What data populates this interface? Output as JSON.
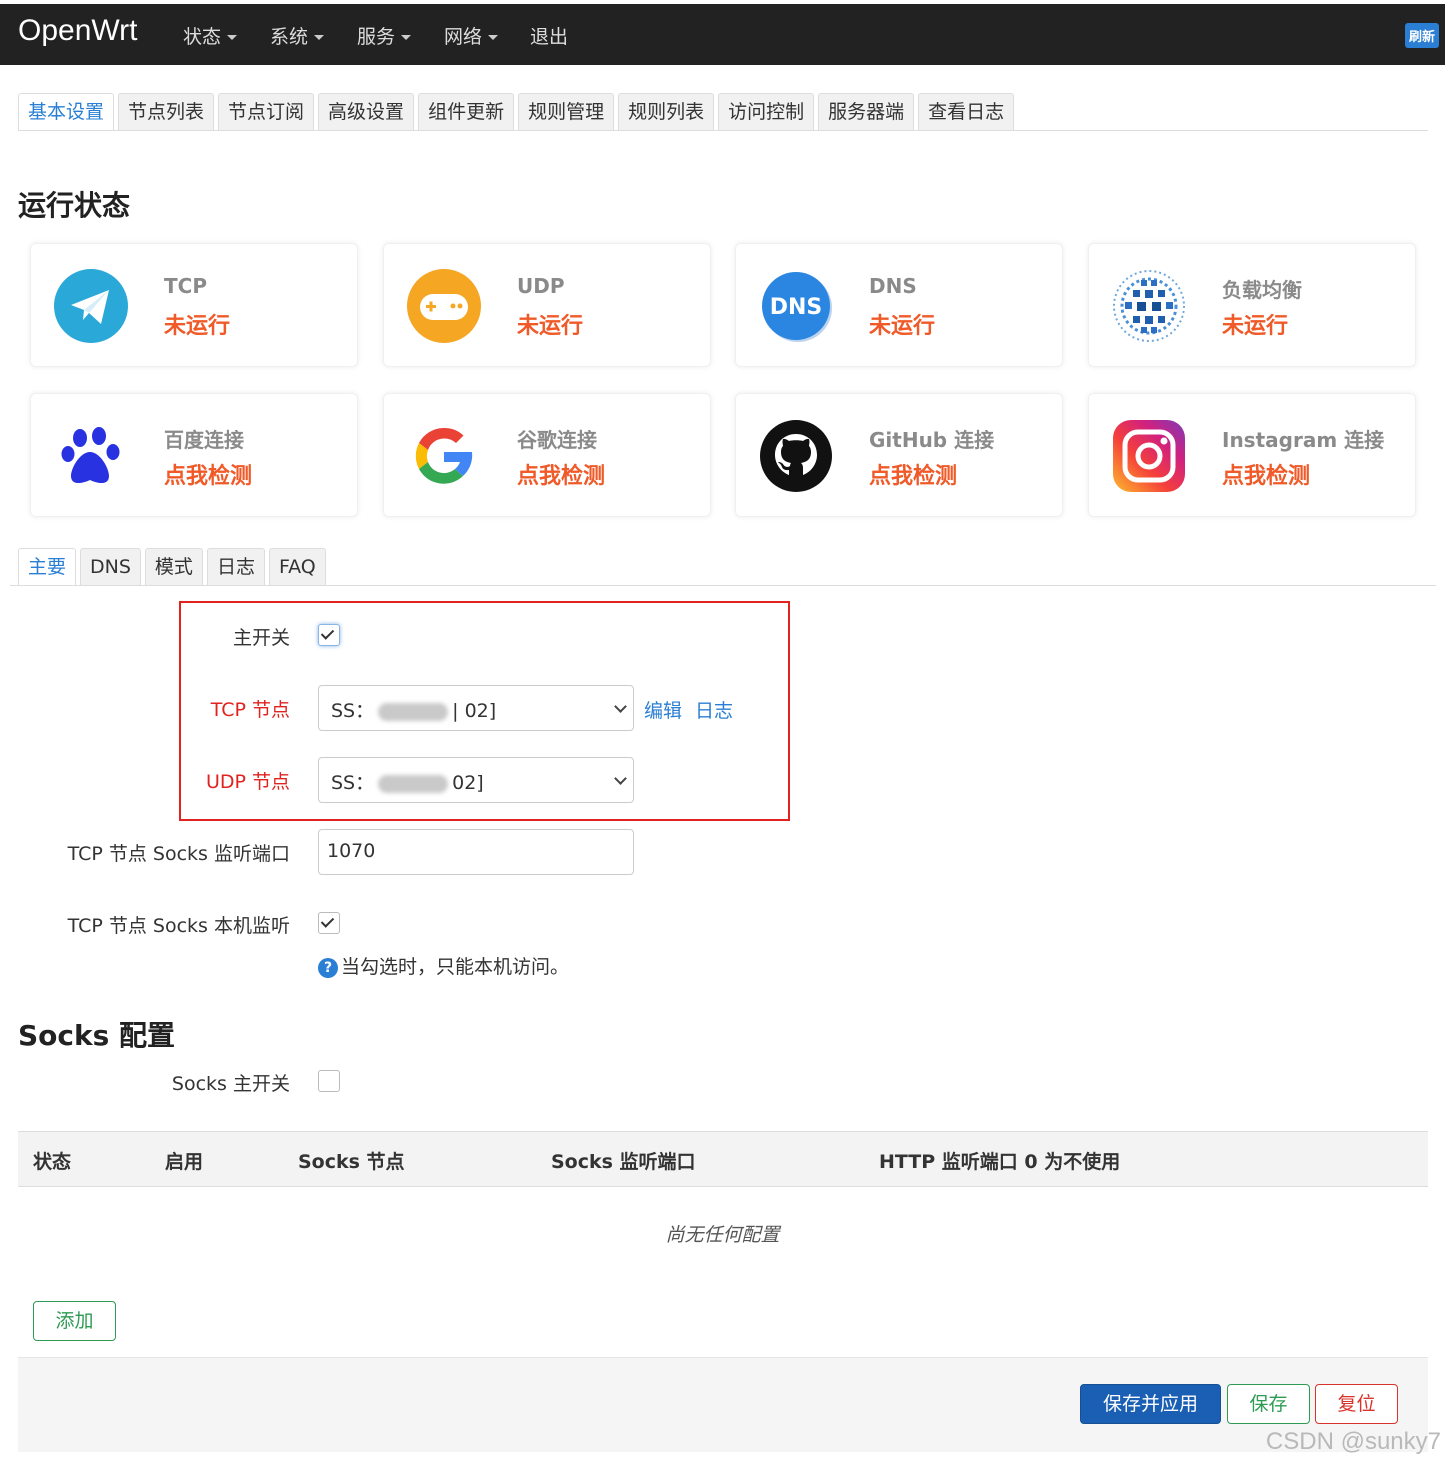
{
  "navbar": {
    "brand": "OpenWrt",
    "menu": [
      "状态",
      "系统",
      "服务",
      "网络"
    ],
    "logout": "退出",
    "refresh": "刷新"
  },
  "main_tabs": [
    "基本设置",
    "节点列表",
    "节点订阅",
    "高级设置",
    "组件更新",
    "规则管理",
    "规则列表",
    "访问控制",
    "服务器端",
    "查看日志"
  ],
  "status": {
    "heading": "运行状态",
    "cards": [
      {
        "title": "TCP",
        "value": "未运行",
        "icon": "paper-plane-icon"
      },
      {
        "title": "UDP",
        "value": "未运行",
        "icon": "gamepad-icon"
      },
      {
        "title": "DNS",
        "value": "未运行",
        "icon": "dns-icon"
      },
      {
        "title": "负载均衡",
        "value": "未运行",
        "icon": "load-balance-icon"
      },
      {
        "title": "百度连接",
        "value": "点我检测",
        "icon": "baidu-icon"
      },
      {
        "title": "谷歌连接",
        "value": "点我检测",
        "icon": "google-icon"
      },
      {
        "title": "GitHub 连接",
        "value": "点我检测",
        "icon": "github-icon"
      },
      {
        "title": "Instagram 连接",
        "value": "点我检测",
        "icon": "instagram-icon"
      }
    ],
    "dns_icon_text": "DNS"
  },
  "sub_tabs": [
    "主要",
    "DNS",
    "模式",
    "日志",
    "FAQ"
  ],
  "form": {
    "main_switch_label": "主开关",
    "main_switch": true,
    "tcp_node_label": "TCP 节点",
    "tcp_node_prefix": "SS：",
    "tcp_node_suffix": "| 02]",
    "edit_link": "编辑",
    "log_link": "日志",
    "udp_node_label": "UDP 节点",
    "udp_node_prefix": "SS：",
    "udp_node_suffix": "02]",
    "socks_port_label": "TCP 节点 Socks 监听端口",
    "socks_port_value": "1070",
    "socks_local_label": "TCP 节点 Socks 本机监听",
    "socks_local": true,
    "socks_local_help": "当勾选时，只能本机访问。"
  },
  "socks": {
    "heading": "Socks 配置",
    "switch_label": "Socks 主开关",
    "switch": false,
    "columns": [
      "状态",
      "启用",
      "Socks 节点",
      "Socks 监听端口",
      "HTTP 监听端口 0 为不使用"
    ],
    "empty_text": "尚无任何配置",
    "add_button": "添加"
  },
  "footer": {
    "save_apply": "保存并应用",
    "save": "保存",
    "reset": "复位"
  },
  "watermark": "CSDN @sunky7"
}
